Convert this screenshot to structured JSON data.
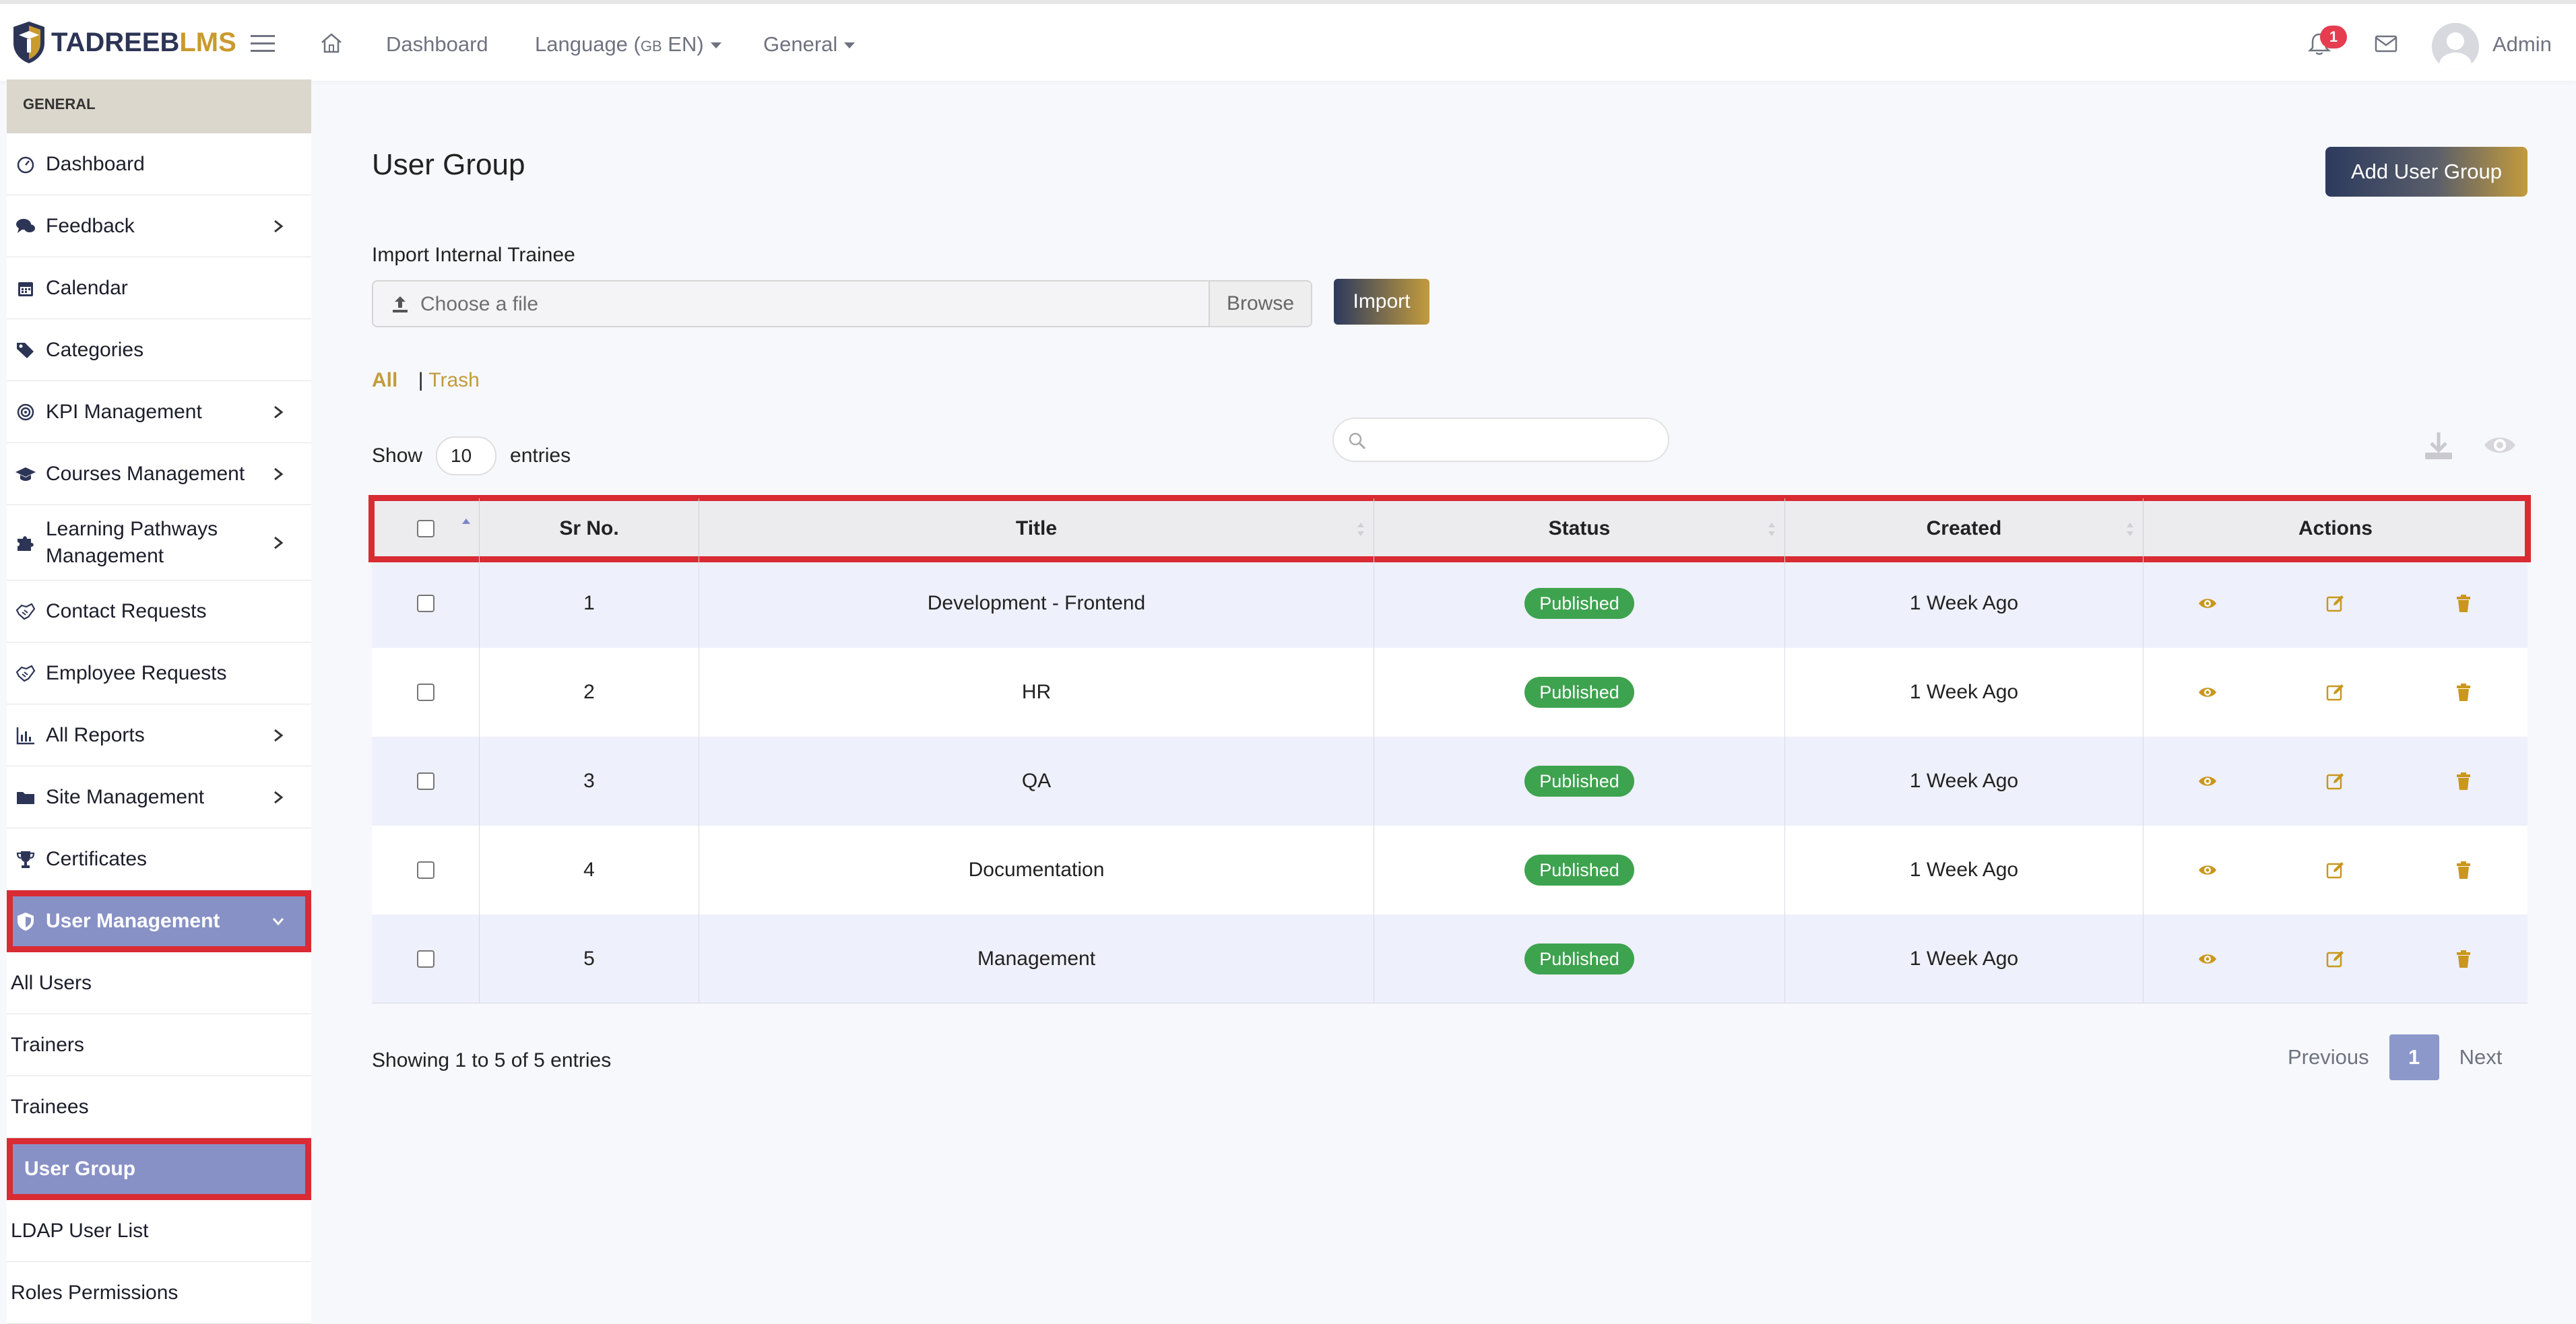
{
  "brand": {
    "part1": "TADREEB",
    "part2": "LMS"
  },
  "topnav": {
    "dashboard": "Dashboard",
    "language_label": "Language (",
    "language_flag": "GB",
    "language_code": " EN)",
    "general": "General",
    "notifications_count": "1",
    "user_name": "Admin"
  },
  "sidebar": {
    "section_title": "GENERAL",
    "items": [
      {
        "label": "Dashboard",
        "icon": "gauge-icon"
      },
      {
        "label": "Feedback",
        "icon": "comments-icon"
      },
      {
        "label": "Calendar",
        "icon": "calendar-icon"
      },
      {
        "label": "Categories",
        "icon": "tags-icon"
      },
      {
        "label": "KPI Management",
        "icon": "target-icon"
      },
      {
        "label": "Courses Management",
        "icon": "graduation-cap-icon"
      },
      {
        "label": "Learning Pathways Management",
        "icon": "puzzle-icon"
      },
      {
        "label": "Contact Requests",
        "icon": "handshake-icon"
      },
      {
        "label": "Employee Requests",
        "icon": "handshake-icon"
      },
      {
        "label": "All Reports",
        "icon": "chart-icon"
      },
      {
        "label": "Site Management",
        "icon": "folder-icon"
      },
      {
        "label": "Certificates",
        "icon": "trophy-icon"
      },
      {
        "label": "User Management",
        "icon": "user-shield-icon"
      }
    ],
    "sub_items": [
      "All Users",
      "Trainers",
      "Trainees",
      "User Group",
      "LDAP User List",
      "Roles Permissions"
    ]
  },
  "main": {
    "title": "User Group",
    "add_button": "Add User Group",
    "import_label": "Import Internal Trainee",
    "file_placeholder": "Choose a file",
    "browse": "Browse",
    "import_button": "Import",
    "filter_all": "All",
    "filter_sep": "|",
    "filter_trash": "Trash",
    "show_label": "Show",
    "entries_value": "10",
    "entries_label": "entries",
    "search_value": ""
  },
  "table": {
    "columns": [
      "Sr No.",
      "Title",
      "Status",
      "Created",
      "Actions"
    ],
    "rows": [
      {
        "sr": "1",
        "title": "Development - Frontend",
        "status": "Published",
        "created": "1 Week Ago"
      },
      {
        "sr": "2",
        "title": "HR",
        "status": "Published",
        "created": "1 Week Ago"
      },
      {
        "sr": "3",
        "title": "QA",
        "status": "Published",
        "created": "1 Week Ago"
      },
      {
        "sr": "4",
        "title": "Documentation",
        "status": "Published",
        "created": "1 Week Ago"
      },
      {
        "sr": "5",
        "title": "Management",
        "status": "Published",
        "created": "1 Week Ago"
      }
    ]
  },
  "footer": {
    "info": "Showing 1 to 5 of 5 entries",
    "previous": "Previous",
    "page": "1",
    "next": "Next"
  },
  "colors": {
    "brand_navy": "#2d3556",
    "brand_gold": "#c99a2e",
    "active_purple": "#8891c5",
    "highlight_red": "#d92b33",
    "status_green": "#3ea34f",
    "action_gold": "#c9971d"
  }
}
